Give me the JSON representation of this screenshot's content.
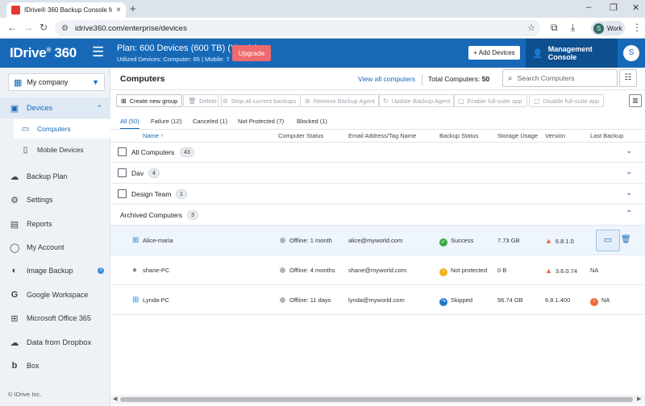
{
  "browser": {
    "tab_title": "IDrive® 360 Backup Console fo",
    "tab_close": "×",
    "new_tab": "+",
    "url": "idrive360.com/enterprise/devices",
    "profile_initial": "S",
    "profile_label": "Work",
    "controls": {
      "minimize": "–",
      "maximize": "❐",
      "close": "✕"
    }
  },
  "header": {
    "logo": "IDrive",
    "logo_suffix": "360",
    "plan_title": "Plan: 600 Devices (600 TB) (Yearly)",
    "plan_sub": "Utilized Devices: Computer: 65 |  Mobile: 7",
    "upgrade_label": "Upgrade",
    "add_devices_label": "+ Add Devices",
    "console_label": "Management Console",
    "user_initial": "S"
  },
  "sidebar": {
    "company": "My company",
    "devices_label": "Devices",
    "sub_items": [
      {
        "label": "Computers",
        "icon": "monitor-icon"
      },
      {
        "label": "Mobile Devices",
        "icon": "phone-icon"
      }
    ],
    "items": [
      {
        "label": "Backup Plan",
        "icon": "cloud-icon"
      },
      {
        "label": "Settings",
        "icon": "gear-icon"
      },
      {
        "label": "Reports",
        "icon": "document-icon"
      },
      {
        "label": "My Account",
        "icon": "user-icon"
      },
      {
        "label": "Image Backup",
        "icon": "image-backup-icon"
      },
      {
        "label": "Google Workspace",
        "icon": "google-icon"
      },
      {
        "label": "Microsoft Office 365",
        "icon": "microsoft-icon"
      },
      {
        "label": "Data from Dropbox",
        "icon": "dropbox-icon"
      },
      {
        "label": "Box",
        "icon": "box-icon"
      }
    ],
    "copyright": "© IDrive Inc."
  },
  "main": {
    "title": "Computers",
    "view_all": "View all computers",
    "total_label": "Total Computers:",
    "total_value": "50",
    "search_placeholder": "Search Computers",
    "toolbar": [
      {
        "label": "Create new group",
        "enabled": true
      },
      {
        "label": "Delete",
        "enabled": false
      },
      {
        "label": "Stop all current backups",
        "enabled": false
      },
      {
        "label": "Remove Backup Agent",
        "enabled": false
      },
      {
        "label": "Update Backup Agent",
        "enabled": false
      },
      {
        "label": "Enable full-suite app",
        "enabled": false
      },
      {
        "label": "Disable full-suite app",
        "enabled": false
      }
    ],
    "filter_tabs": [
      "All (50)",
      "Failure (12)",
      "Canceled (1)",
      "Not Protected (7)",
      "Blocked (1)"
    ],
    "columns": [
      "Name",
      "Computer Status",
      "Email Address/Tag Name",
      "Backup Status",
      "Storage Usage",
      "Version",
      "Last Backup"
    ],
    "groups": [
      {
        "name": "All Computers",
        "count": "43"
      },
      {
        "name": "Dav",
        "count": "4"
      },
      {
        "name": "Design Team",
        "count": "1"
      }
    ],
    "archived": {
      "name": "Archived Computers",
      "count": "3"
    },
    "rows": [
      {
        "name": "Alice-maria",
        "os": "windows",
        "status": "Offline: 1 month",
        "email": "alice@myworld.com",
        "backup": "Success",
        "backup_type": "success",
        "storage": "7.73 GB",
        "version": "6.8.1.0",
        "last_backup": ""
      },
      {
        "name": "shane-PC",
        "os": "apple",
        "status": "Offline: 4 months",
        "email": "shane@myworld.com",
        "backup": "Not protected",
        "backup_type": "notprot",
        "storage": "0 B",
        "version": "3.6.0.74",
        "last_backup": "NA"
      },
      {
        "name": "Lynda-PC",
        "os": "windows",
        "status": "Offline: 11 days",
        "email": "lynda@myworld.com",
        "backup": "Skipped",
        "backup_type": "skip",
        "storage": "56.74 GB",
        "version": "6.8.1.400",
        "last_backup": "NA"
      }
    ]
  },
  "colors": {
    "brand": "#1769b8",
    "console_dark": "#0d4f8f",
    "upgrade": "#ef6a6e",
    "success": "#3cab45",
    "warning": "#f0b51e",
    "skipped": "#1e74cf"
  }
}
